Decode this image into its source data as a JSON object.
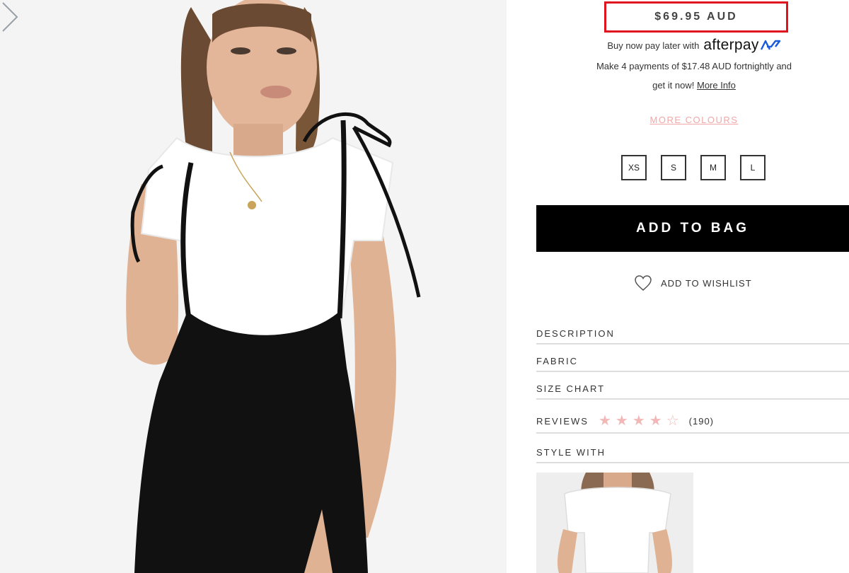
{
  "product": {
    "price": "$69.95 AUD"
  },
  "afterpay": {
    "intro": "Buy now pay later with",
    "logo_text": "afterpay",
    "payments": "Make 4 payments of $17.48 AUD fortnightly and",
    "get_it": "get it now!",
    "more_info": "More Info"
  },
  "more_colours": "MORE COLOURS",
  "sizes": [
    "XS",
    "S",
    "M",
    "L"
  ],
  "add_to_bag": "ADD TO BAG",
  "wishlist": {
    "label": "ADD TO WISHLIST",
    "icon": "heart-outline"
  },
  "accordion": {
    "description": "DESCRIPTION",
    "fabric": "FABRIC",
    "size_chart": "SIZE CHART",
    "reviews": "REVIEWS",
    "review_count": "(190)",
    "rating": 4.5,
    "style_with": "STYLE WITH"
  },
  "colors": {
    "price_highlight": "#e0141e",
    "more_colours": "#f0a8a8",
    "stars": "#f2b8b8",
    "button": "#000000"
  },
  "icons": {
    "carousel_next": "chevron-right-icon",
    "wishlist": "heart-icon"
  }
}
